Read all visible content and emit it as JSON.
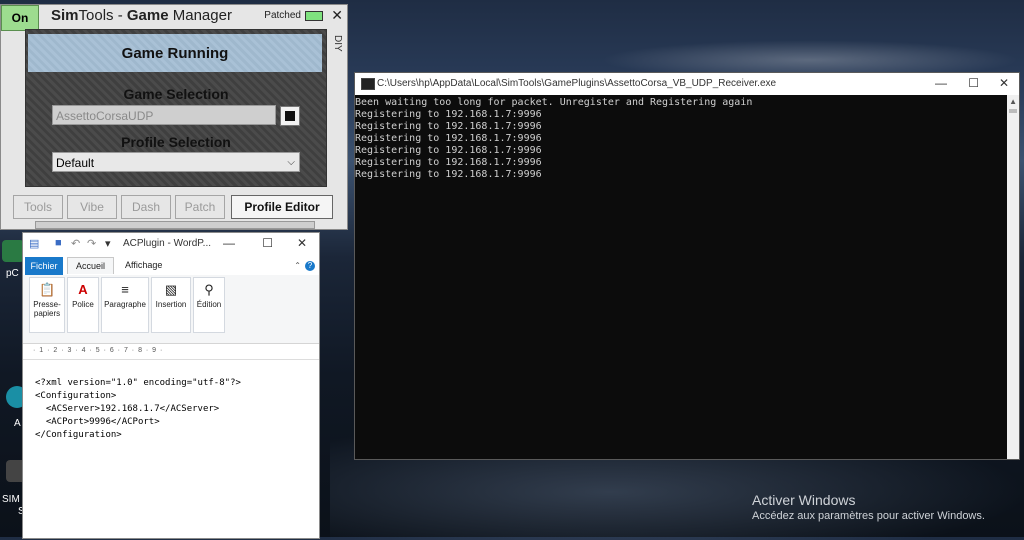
{
  "simtools": {
    "on_label": "On",
    "title_sim": "Sim",
    "title_tools": "Tools - ",
    "title_game": "Game",
    "title_manager": " Manager",
    "patched_label": "Patched",
    "close_label": "✕",
    "diy_label": "DIY",
    "status": "Game Running",
    "game_selection_label": "Game Selection",
    "game_selection_value": "AssettoCorsaUDP",
    "profile_selection_label": "Profile Selection",
    "profile_selection_value": "Default",
    "tabs": [
      "Tools",
      "Vibe",
      "Dash",
      "Patch",
      "Profile Editor"
    ]
  },
  "console": {
    "title": "C:\\Users\\hp\\AppData\\Local\\SimTools\\GamePlugins\\AssettoCorsa_VB_UDP_Receiver.exe",
    "lines": [
      "Been waiting too long for packet. Unregister and Registering again",
      "Registering to 192.168.1.7:9996",
      "Registering to 192.168.1.7:9996",
      "Registering to 192.168.1.7:9996",
      "Registering to 192.168.1.7:9996",
      "Registering to 192.168.1.7:9996",
      "Registering to 192.168.1.7:9996"
    ]
  },
  "wordpad": {
    "title": "ACPlugin - WordP...",
    "tabs": [
      "Fichier",
      "Accueil",
      "Affichage"
    ],
    "groups": [
      "Presse-\npapiers",
      "Police",
      "Paragraphe",
      "Insertion",
      "Édition"
    ],
    "ruler": "· 1 · 2 · 3 · 4 · 5 · 6 · 7 · 8 · 9 ·",
    "doc_lines": [
      "<?xml version=\"1.0\" encoding=\"utf-8\"?>",
      "<Configuration>",
      "  <ACServer>192.168.1.7</ACServer>",
      "  <ACPort>9996</ACPort>",
      "</Configuration>"
    ]
  },
  "desktop": {
    "icon_labels": [
      "pC",
      "A",
      "SIM D",
      "S"
    ]
  },
  "activation": {
    "title": "Activer Windows",
    "subtitle": "Accédez aux paramètres pour activer Windows."
  },
  "colors": {
    "on_green": "#9ddc8f",
    "game_running_blue": "#a9c1d6",
    "wordpad_blue": "#1979ca",
    "console_bg": "#0c0c0c"
  }
}
